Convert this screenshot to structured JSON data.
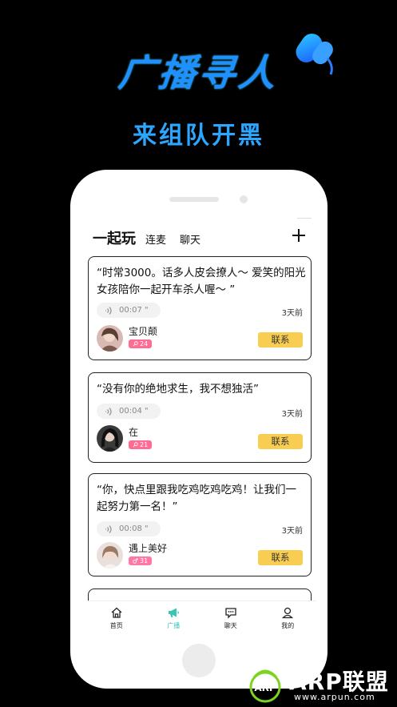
{
  "promo": {
    "title": "广播寻人",
    "subtitle": "来组队开黑"
  },
  "header": {
    "tabs": [
      {
        "label": "一起玩",
        "active": true
      },
      {
        "label": "连麦",
        "active": false
      },
      {
        "label": "聊天",
        "active": false
      }
    ],
    "add_icon": "plus-icon"
  },
  "posts": [
    {
      "quote": "“时常3000。话多人皮会撩人～ 爱笑的阳光女孩陪你一起开车杀人喔～ ”",
      "duration": "00:07 \"",
      "time": "3天前",
      "user": "宝贝颠",
      "badge_icon": "female-icon",
      "badge_value": "24",
      "contact_label": "联系"
    },
    {
      "quote": "“没有你的绝地求生，我不想独活”",
      "duration": "00:04 \"",
      "time": "3天前",
      "user": "在",
      "badge_icon": "female-icon",
      "badge_value": "21",
      "contact_label": "联系"
    },
    {
      "quote": "“你，快点里跟我吃鸡吃鸡吃鸡！让我们一起努力第一名！”",
      "duration": "00:08 \"",
      "time": "3天前",
      "user": "遇上美好",
      "badge_icon": "male-icon",
      "badge_value": "31",
      "contact_label": "联系"
    }
  ],
  "nav": [
    {
      "label": "首页",
      "icon": "home-icon"
    },
    {
      "label": "广播",
      "icon": "megaphone-icon",
      "active": true
    },
    {
      "label": "聊天",
      "icon": "chat-icon"
    },
    {
      "label": "我的",
      "icon": "profile-icon"
    }
  ],
  "watermark": {
    "text": "ARP联盟",
    "url": "www.arpun.com"
  },
  "colors": {
    "accent_blue": "#1e90ff",
    "contact_yellow": "#f8cd51",
    "badge_pink": "#ff6b93",
    "nav_active": "#3cc4b5"
  }
}
